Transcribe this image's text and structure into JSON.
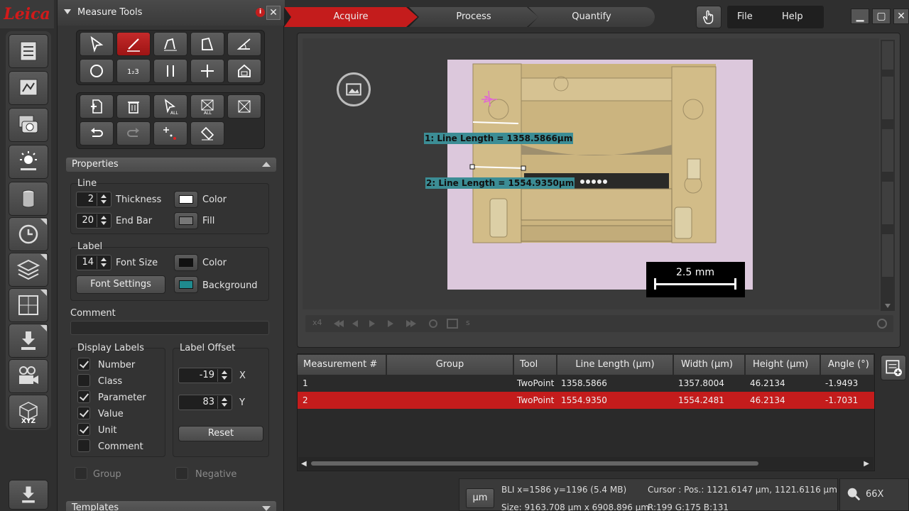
{
  "app": {
    "logo": "Leica"
  },
  "workflow": {
    "steps": [
      "Acquire",
      "Process",
      "Quantify"
    ],
    "active": "Acquire"
  },
  "menu": {
    "file": "File",
    "help": "Help"
  },
  "measure_tools": {
    "title": "Measure Tools",
    "properties_title": "Properties",
    "line": {
      "title": "Line",
      "thickness_value": "2",
      "thickness_label": "Thickness",
      "endbar_value": "20",
      "endbar_label": "End Bar",
      "color_label": "Color",
      "fill_label": "Fill",
      "line_color": "#ffffff",
      "fill_color": "#777777"
    },
    "label": {
      "title": "Label",
      "font_size_value": "14",
      "font_size_label": "Font Size",
      "color_label": "Color",
      "font_settings_button": "Font Settings",
      "background_label": "Background",
      "label_color": "#111111",
      "background_color": "#1f8a8e"
    },
    "comment_label": "Comment",
    "display_labels": {
      "title": "Display Labels",
      "items": [
        {
          "label": "Number",
          "checked": true
        },
        {
          "label": "Class",
          "checked": false
        },
        {
          "label": "Parameter",
          "checked": true
        },
        {
          "label": "Value",
          "checked": true
        },
        {
          "label": "Unit",
          "checked": true
        },
        {
          "label": "Comment",
          "checked": false
        }
      ]
    },
    "label_offset": {
      "title": "Label Offset",
      "x_value": "-19",
      "x_label": "X",
      "y_value": "83",
      "y_label": "Y",
      "reset_button": "Reset"
    },
    "group_label": "Group",
    "negative_label": "Negative",
    "templates_title": "Templates"
  },
  "viewer": {
    "measurement_labels": [
      "1: Line Length = 1358.5866µm",
      "2: Line Length = 1554.9350µm"
    ],
    "scale_bar": "2.5 mm",
    "play_label_x4": "x4",
    "play_label_s": "s"
  },
  "table": {
    "columns": [
      "Measurement #",
      "Group",
      "Tool",
      "Line Length (µm)",
      "Width (µm)",
      "Height (µm)",
      "Angle (°)"
    ],
    "rows": [
      {
        "num": "1",
        "group": "",
        "tool": "TwoPoint",
        "length": "1358.5866",
        "width": "1357.8004",
        "height": "46.2134",
        "angle": "-1.9493",
        "selected": false
      },
      {
        "num": "2",
        "group": "",
        "tool": "TwoPoint",
        "length": "1554.9350",
        "width": "1554.2481",
        "height": "46.2134",
        "angle": "-1.7031",
        "selected": true
      }
    ]
  },
  "status": {
    "unit_button": "µm",
    "bli": "BLI x=1586 y=1196  (5.4 MB)",
    "size": "Size: 9163.708 µm x 6908.896 µm",
    "cursor_pos": "Cursor :  Pos.: 1121.6147 µm, 1121.6116 µm",
    "rgb": "R:199 G:175 B:131",
    "zoom": "66X"
  },
  "colors": {
    "accent": "#c41c1c",
    "label_bg": "#3c8d95"
  }
}
